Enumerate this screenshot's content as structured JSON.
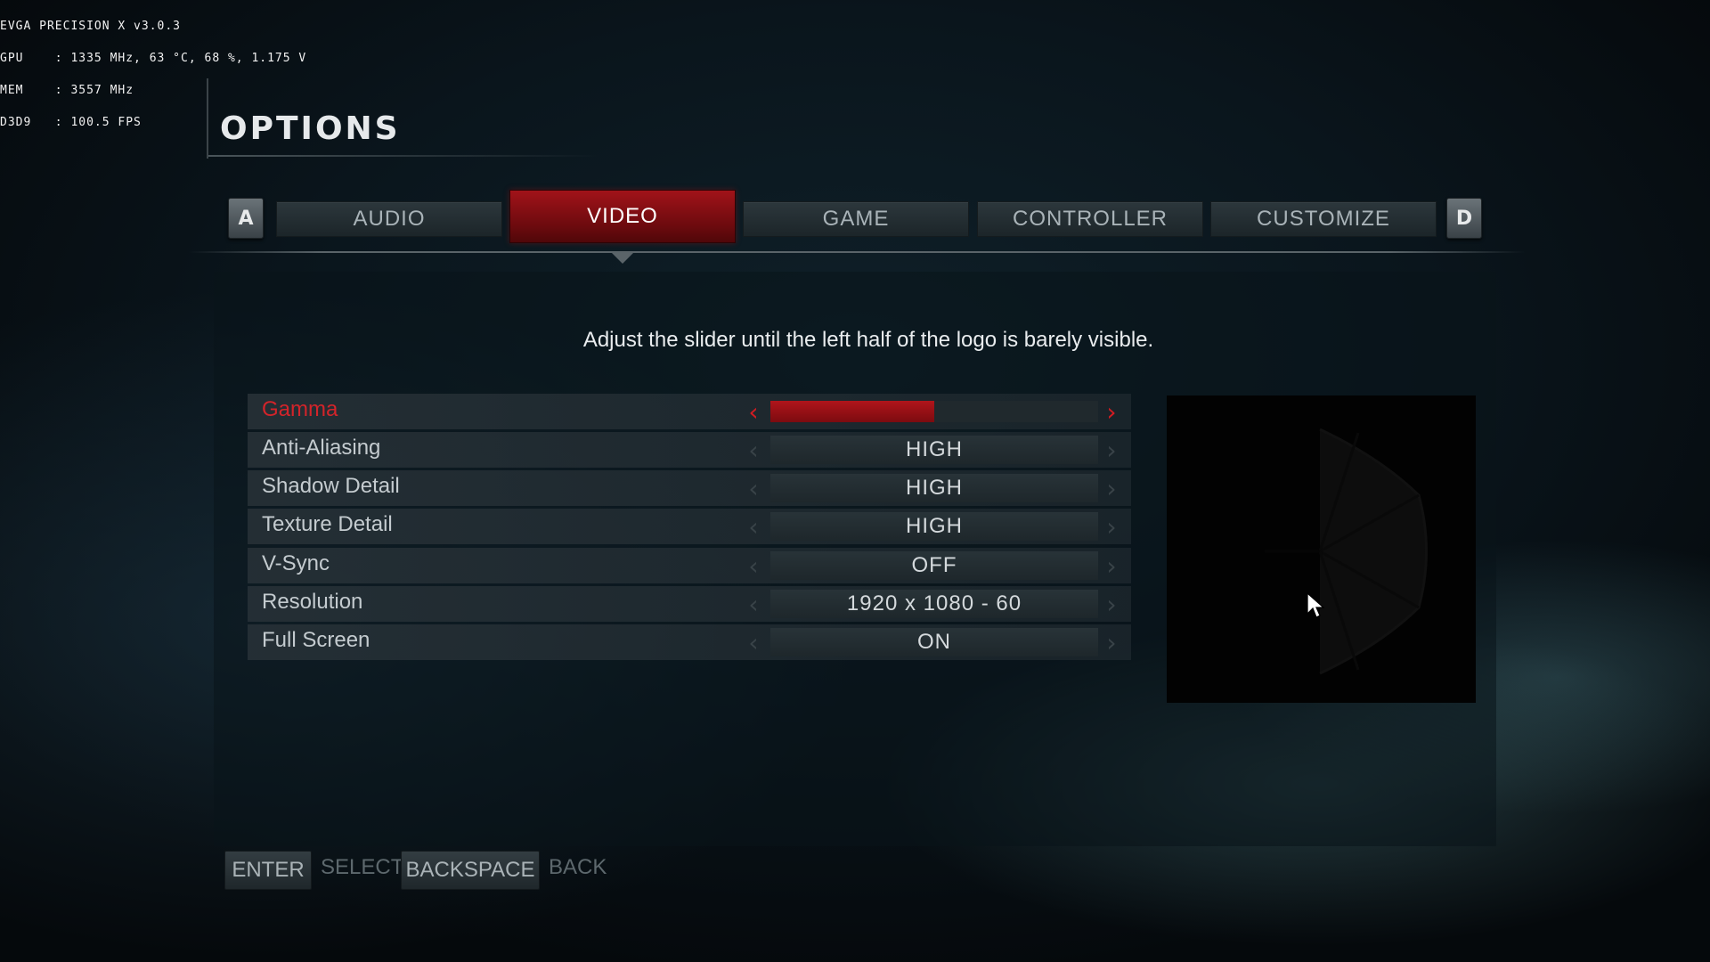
{
  "overlay": {
    "line1": "EVGA PRECISION X v3.0.3",
    "line2": "GPU    : 1335 MHz, 63 °C, 68 %, 1.175 V",
    "line3": "MEM    : 3557 MHz",
    "line4": "D3D9   : 100.5 FPS"
  },
  "page": {
    "title": "OPTIONS"
  },
  "keys": {
    "prev": "A",
    "next": "D"
  },
  "tabs": [
    {
      "label": "AUDIO",
      "active": false
    },
    {
      "label": "VIDEO",
      "active": true
    },
    {
      "label": "GAME",
      "active": false
    },
    {
      "label": "CONTROLLER",
      "active": false
    },
    {
      "label": "CUSTOMIZE",
      "active": false
    }
  ],
  "instructions": "Adjust the slider until the left half of the logo is barely visible.",
  "settings": {
    "gamma": {
      "label": "Gamma",
      "level": 0.5
    },
    "anti_aliasing": {
      "label": "Anti-Aliasing",
      "value": "HIGH"
    },
    "shadow_detail": {
      "label": "Shadow Detail",
      "value": "HIGH"
    },
    "texture_detail": {
      "label": "Texture Detail",
      "value": "HIGH"
    },
    "vsync": {
      "label": "V-Sync",
      "value": "OFF"
    },
    "resolution": {
      "label": "Resolution",
      "value": "1920 x 1080 - 60"
    },
    "full_screen": {
      "label": "Full Screen",
      "value": "ON"
    }
  },
  "footer": {
    "enter_key": "ENTER",
    "enter_action": "SELECT",
    "back_key": "BACKSPACE",
    "back_action": "BACK"
  },
  "colors": {
    "accent": "#c0181e",
    "panel": "#0a151c"
  },
  "icons": {
    "arrow_left": "‹",
    "arrow_right": "›",
    "logo": "umbrella-logo"
  }
}
